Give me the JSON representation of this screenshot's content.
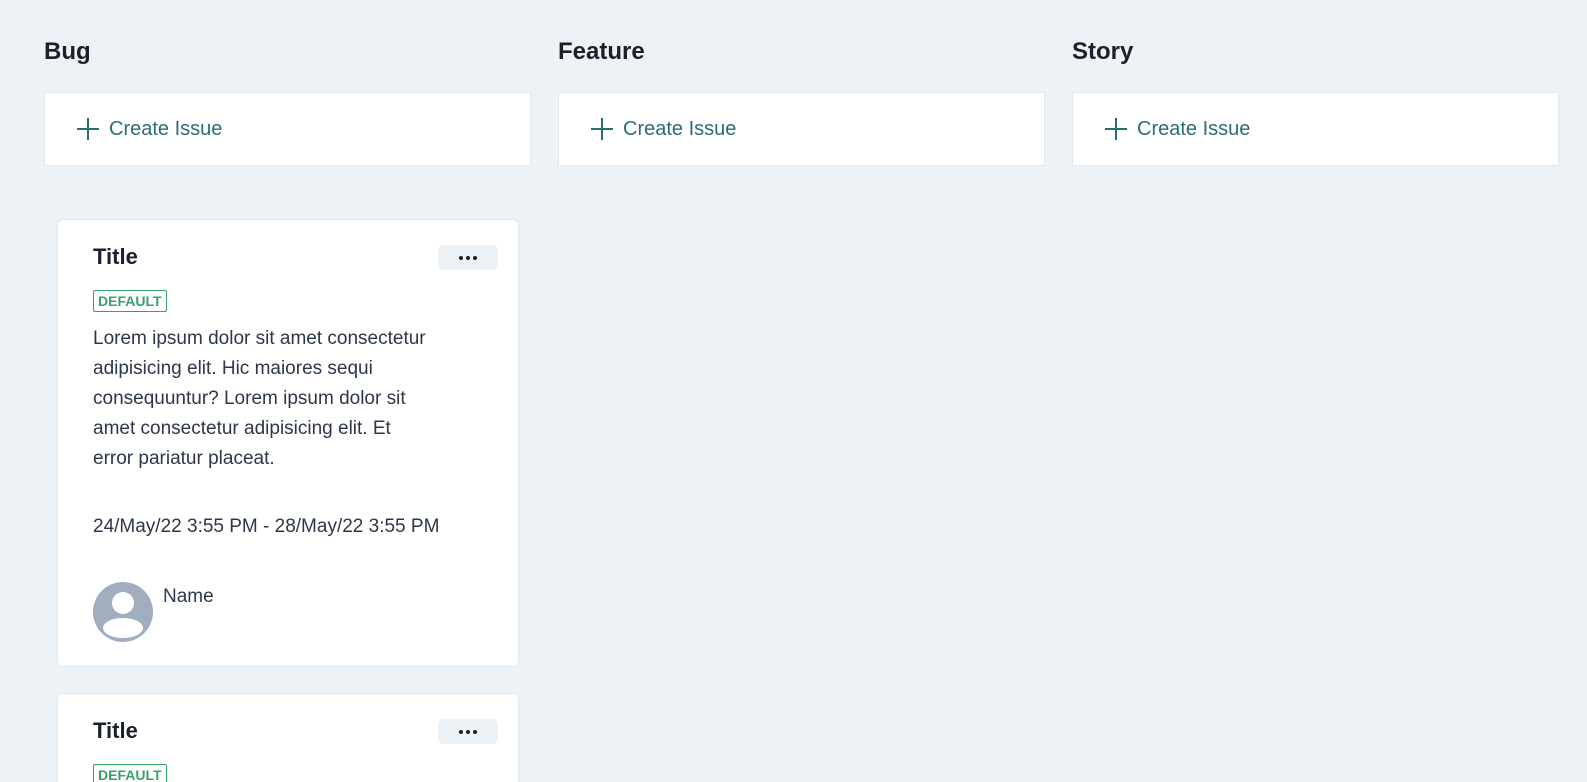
{
  "columns": [
    {
      "title": "Bug",
      "create_label": "Create Issue"
    },
    {
      "title": "Feature",
      "create_label": "Create Issue"
    },
    {
      "title": "Story",
      "create_label": "Create Issue"
    }
  ],
  "cards": [
    {
      "title": "Title",
      "badge": "DEFAULT",
      "description": "Lorem ipsum dolor sit amet consectetur adipisicing elit. Hic maiores sequi consequuntur? Lorem ipsum dolor sit amet consectetur adipisicing elit. Et error pariatur placeat.",
      "date_range": "24/May/22 3:55 PM - 28/May/22 3:55 PM",
      "assignee": "Name",
      "menu_icon": "more-horizontal-icon",
      "avatar_icon": "user-avatar-icon"
    },
    {
      "title": "Title",
      "badge": "DEFAULT",
      "menu_icon": "more-horizontal-icon"
    }
  ],
  "colors": {
    "background": "#edf2f7",
    "accent": "#2c6e6f",
    "badge": "#38a169",
    "avatar": "#a0aec0"
  }
}
